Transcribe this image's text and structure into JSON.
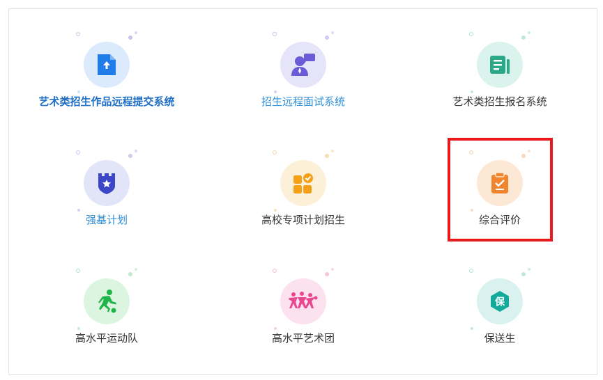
{
  "tiles": [
    {
      "label": "艺术类招生作品远程提交系统",
      "icon": "file-upload-icon",
      "bg": "#dbeafc",
      "accent": "#1f7ce8"
    },
    {
      "label": "招生远程面试系统",
      "icon": "interview-person-icon",
      "bg": "#e6e4f9",
      "accent": "#6b5bd6"
    },
    {
      "label": "艺术类招生报名系统",
      "icon": "form-document-icon",
      "bg": "#daf3ec",
      "accent": "#2ba888"
    },
    {
      "label": "强基计划",
      "icon": "castle-shield-icon",
      "bg": "#e2e4f8",
      "accent": "#3c47c8"
    },
    {
      "label": "高校专项计划招生",
      "icon": "grid-check-icon",
      "bg": "#fdf0d8",
      "accent": "#f5a117"
    },
    {
      "label": "综合评价",
      "icon": "clipboard-check-icon",
      "bg": "#fde8d6",
      "accent": "#f0852d"
    },
    {
      "label": "高水平运动队",
      "icon": "soccer-player-icon",
      "bg": "#dcf5e0",
      "accent": "#21b44a"
    },
    {
      "label": "高水平艺术团",
      "icon": "dancers-icon",
      "bg": "#fce2ee",
      "accent": "#e8468f"
    },
    {
      "label": "保送生",
      "icon": "recommend-badge-icon",
      "bg": "#d9f2ef",
      "accent": "#13a99b",
      "badge_text": "保"
    }
  ]
}
